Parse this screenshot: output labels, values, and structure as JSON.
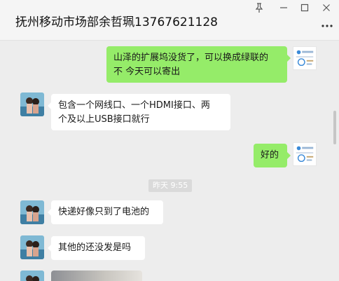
{
  "window": {
    "title": "抚州移动市场部余哲珮13767621128",
    "controls": [
      "pin-icon",
      "minimize-icon",
      "maximize-icon",
      "close-icon",
      "more-icon"
    ]
  },
  "messages": [
    {
      "direction": "out",
      "text_line1": "山泽的扩展坞没货了，可以换成绿联的",
      "text_line2": "不  今天可以寄出"
    },
    {
      "direction": "in",
      "text_line1": "包含一个网线口、一个HDMI接口、两",
      "text_line2": "个及以上USB接口就行"
    },
    {
      "direction": "out",
      "text": "好的"
    },
    {
      "direction": "in",
      "text": "快递好像只到了电池的"
    },
    {
      "direction": "in",
      "text": "其他的还没发是吗"
    }
  ],
  "timestamp": "昨天 9:55",
  "colors": {
    "outgoing_bubble": "#95ec69",
    "incoming_bubble": "#ffffff",
    "background": "#ededed"
  }
}
